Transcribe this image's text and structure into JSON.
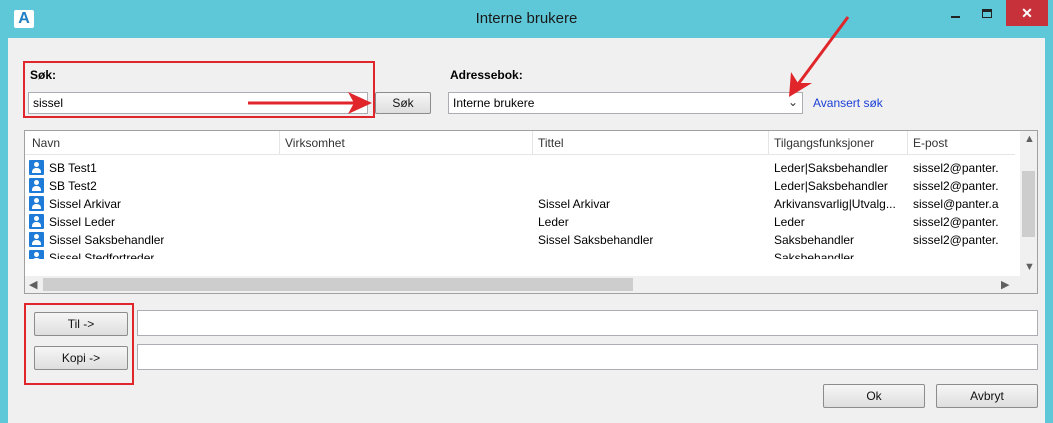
{
  "window": {
    "title": "Interne brukere",
    "app_icon_letter": "A",
    "close_glyph": "✕"
  },
  "search": {
    "label": "Søk:",
    "value": "sissel",
    "button_label": "Søk"
  },
  "addressbook": {
    "label": "Adressebok:",
    "selected": "Interne brukere",
    "advanced_link": "Avansert søk"
  },
  "table": {
    "columns": [
      "Navn",
      "Virksomhet",
      "Tittel",
      "Tilgangsfunksjoner",
      "E-post"
    ],
    "rows": [
      {
        "name": "SB Test1",
        "company": "",
        "title": "",
        "access": "Leder|Saksbehandler",
        "email": "sissel2@panter."
      },
      {
        "name": "SB Test2",
        "company": "",
        "title": "",
        "access": "Leder|Saksbehandler",
        "email": "sissel2@panter."
      },
      {
        "name": "Sissel Arkivar",
        "company": "",
        "title": "Sissel Arkivar",
        "access": "Arkivansvarlig|Utvalg...",
        "email": "sissel@panter.a"
      },
      {
        "name": "Sissel Leder",
        "company": "",
        "title": "Leder",
        "access": "Leder",
        "email": "sissel2@panter."
      },
      {
        "name": "Sissel Saksbehandler",
        "company": "",
        "title": "Sissel Saksbehandler",
        "access": "Saksbehandler",
        "email": "sissel2@panter."
      },
      {
        "name": "Sissel Stedfortreder",
        "company": "",
        "title": "",
        "access": "Saksbehandler",
        "email": ""
      }
    ]
  },
  "recipients": {
    "to_label": "Til ->",
    "to_value": "",
    "cc_label": "Kopi ->",
    "cc_value": ""
  },
  "footer": {
    "ok_label": "Ok",
    "cancel_label": "Avbryt"
  },
  "colors": {
    "titlebar": "#5fc8d8",
    "annotation_red": "#e0262b",
    "link": "#1c3fd6",
    "user_icon": "#1e7bd8"
  }
}
